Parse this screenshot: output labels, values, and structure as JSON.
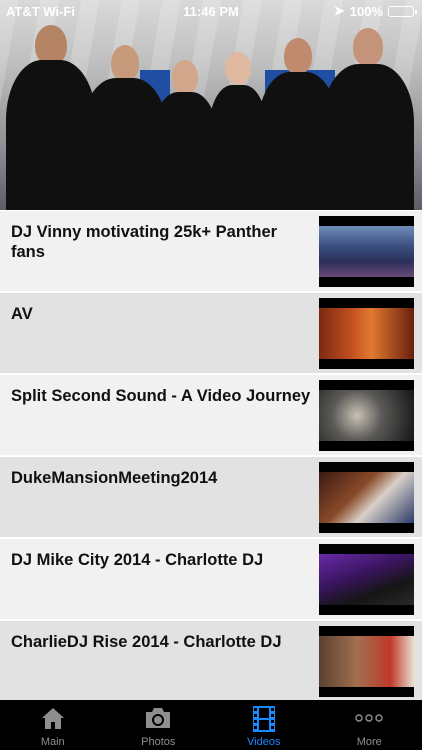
{
  "status_bar": {
    "carrier": "AT&T Wi-Fi",
    "time": "11:46 PM",
    "battery": "100%",
    "battery_level": 1.0
  },
  "videos": [
    {
      "title": "DJ Vinny motivating 25k+ Panther fans",
      "thumb": "stadium-crowd"
    },
    {
      "title": "AV",
      "thumb": "event-hall"
    },
    {
      "title": "Split Second Sound - A Video Journey",
      "thumb": "dance-party"
    },
    {
      "title": "DukeMansionMeeting2014",
      "thumb": "dj-booth"
    },
    {
      "title": "DJ Mike City 2014 - Charlotte DJ",
      "thumb": "turntable"
    },
    {
      "title": "CharlieDJ Rise 2014 - Charlotte DJ",
      "thumb": "portrait"
    }
  ],
  "tabs": [
    {
      "label": "Main",
      "icon": "home-icon",
      "active": false
    },
    {
      "label": "Photos",
      "icon": "camera-icon",
      "active": false
    },
    {
      "label": "Videos",
      "icon": "film-icon",
      "active": true
    },
    {
      "label": "More",
      "icon": "more-icon",
      "active": false
    }
  ],
  "colors": {
    "active_tab": "#1a88ff",
    "inactive_tab": "#8e8e8e",
    "tab_bar_bg": "#000000",
    "row_light": "#f1f1f1",
    "row_dark": "#e2e2e2"
  }
}
